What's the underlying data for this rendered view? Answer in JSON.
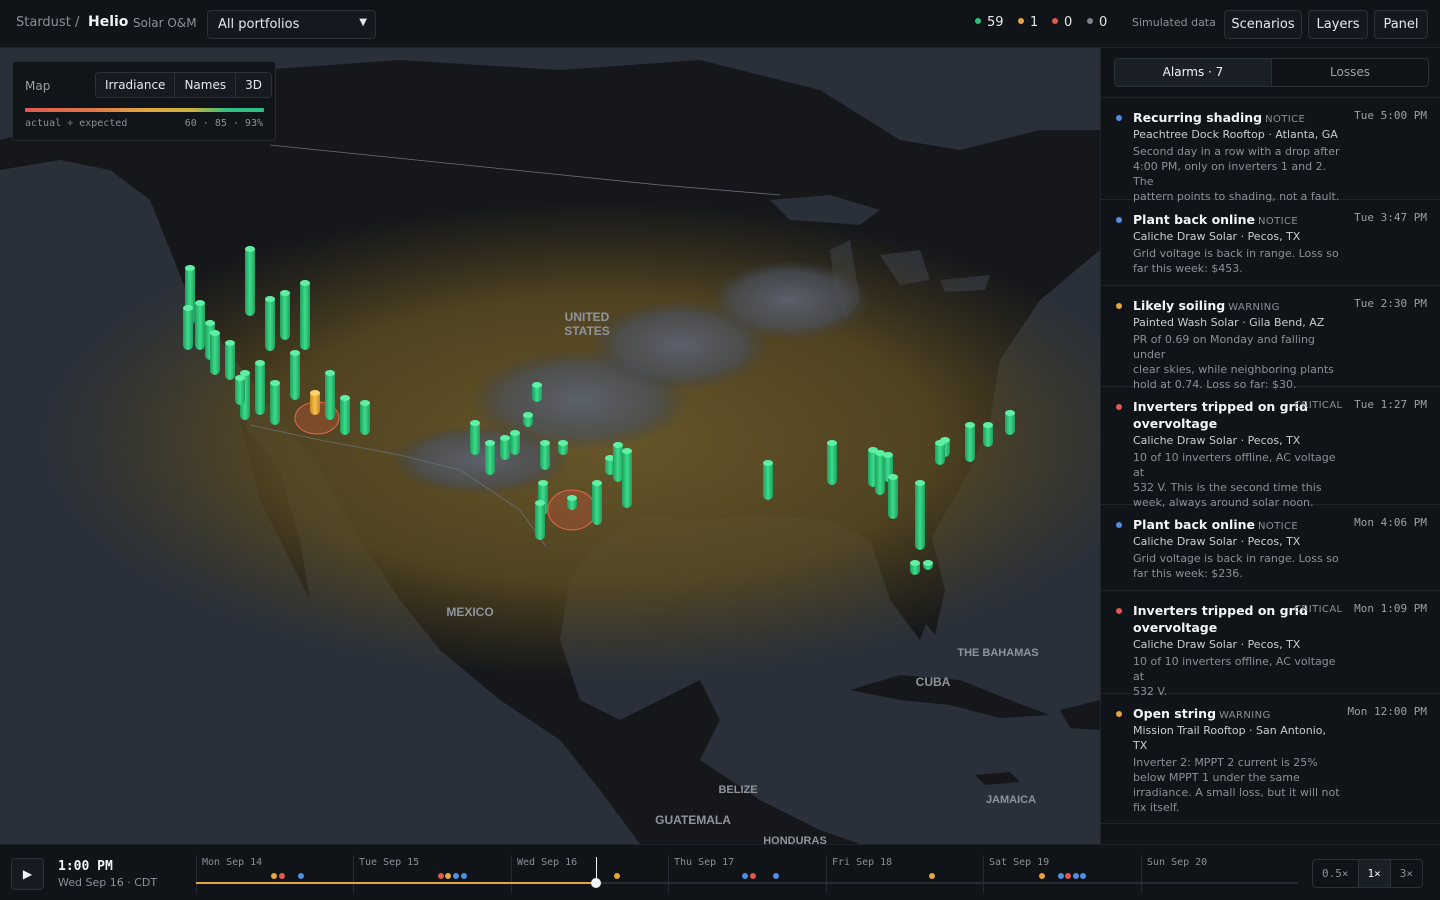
{
  "header": {
    "org": "Stardust",
    "separator": "/",
    "app": "Helio",
    "app_sub": "Solar O&M",
    "portfolio_select": "All portfolios",
    "stats": [
      {
        "value": "59",
        "color": "#2fbf7f"
      },
      {
        "value": "1",
        "color": "#e3a640"
      },
      {
        "value": "0",
        "color": "#e05a4e"
      },
      {
        "value": "0",
        "color": "#7d838c"
      }
    ],
    "simulated": "Simulated data",
    "buttons": {
      "scenarios": "Scenarios",
      "layers": "Layers",
      "panel": "Panel"
    }
  },
  "map_card": {
    "title": "Map",
    "modes": [
      "Irradiance",
      "Names",
      "3D"
    ],
    "ramp_label": "actual ÷ expected",
    "ramp_values": "60 · 85 · 93%"
  },
  "map_labels": {
    "us": [
      "UNITED",
      "STATES"
    ],
    "mexico": "MEXICO",
    "bahamas": "THE BAHAMAS",
    "cuba": "CUBA",
    "belize": "BELIZE",
    "jamaica": "JAMAICA",
    "guatemala": "GUATEMALA",
    "honduras": "HONDURAS"
  },
  "panel": {
    "tabs": {
      "alarms": "Alarms · 7",
      "losses": "Losses"
    },
    "alarms": [
      {
        "title": "Recurring shading",
        "severity": "NOTICE",
        "color": "#4f8ee0",
        "time": "Tue 5:00 PM",
        "site": "Peachtree Dock Rooftop · Atlanta, GA",
        "desc": [
          "Second day in a row with a drop after",
          "4:00 PM, only on inverters 1 and 2. The",
          "pattern points to shading, not a fault."
        ]
      },
      {
        "title": "Plant back online",
        "severity": "NOTICE",
        "color": "#4f8ee0",
        "time": "Tue 3:47 PM",
        "site": "Caliche Draw Solar · Pecos, TX",
        "desc": [
          "Grid voltage is back in range. Loss so",
          "far this week: $453."
        ]
      },
      {
        "title": "Likely soiling",
        "severity": "WARNING",
        "color": "#e3a640",
        "time": "Tue 2:30 PM",
        "site": "Painted Wash Solar · Gila Bend, AZ",
        "desc": [
          "PR of 0.69 on Monday and falling under",
          "clear skies, while neighboring plants",
          "hold at 0.74. Loss so far: $30."
        ]
      },
      {
        "title": [
          "Inverters tripped on grid",
          "overvoltage"
        ],
        "severity": "CRITICAL",
        "color": "#e05a4e",
        "time": "Tue 1:27 PM",
        "site": "Caliche Draw Solar · Pecos, TX",
        "desc": [
          "10 of 10 inverters offline, AC voltage at",
          "532 V. This is the second time this",
          "week, always around solar noon."
        ]
      },
      {
        "title": "Plant back online",
        "severity": "NOTICE",
        "color": "#4f8ee0",
        "time": "Mon 4:06 PM",
        "site": "Caliche Draw Solar · Pecos, TX",
        "desc": [
          "Grid voltage is back in range. Loss so",
          "far this week: $236."
        ]
      },
      {
        "title": [
          "Inverters tripped on grid",
          "overvoltage"
        ],
        "severity": "CRITICAL",
        "color": "#e05a4e",
        "time": "Mon 1:09 PM",
        "site": "Caliche Draw Solar · Pecos, TX",
        "desc": [
          "10 of 10 inverters offline, AC voltage at",
          "532 V."
        ]
      },
      {
        "title": "Open string",
        "severity": "WARNING",
        "color": "#e3a640",
        "time": "Mon 12:00 PM",
        "site": [
          "Mission Trail Rooftop · San Antonio,",
          "TX"
        ],
        "desc": [
          "Inverter 2: MPPT 2 current is 25%",
          "below MPPT 1 under the same",
          "irradiance. A small loss, but it will not",
          "fix itself."
        ]
      }
    ]
  },
  "bottom": {
    "play_icon": "▶",
    "time": "1:00 PM",
    "date": "Wed Sep 16 · CDT",
    "days": [
      "Mon Sep 14",
      "Tue Sep 15",
      "Wed Sep 16",
      "Thu Sep 17",
      "Fri Sep 18",
      "Sat Sep 19",
      "Sun Sep 20"
    ],
    "progress": 0.363,
    "speeds": [
      "0.5×",
      "1×",
      "3×"
    ],
    "active_speed": "1×"
  }
}
